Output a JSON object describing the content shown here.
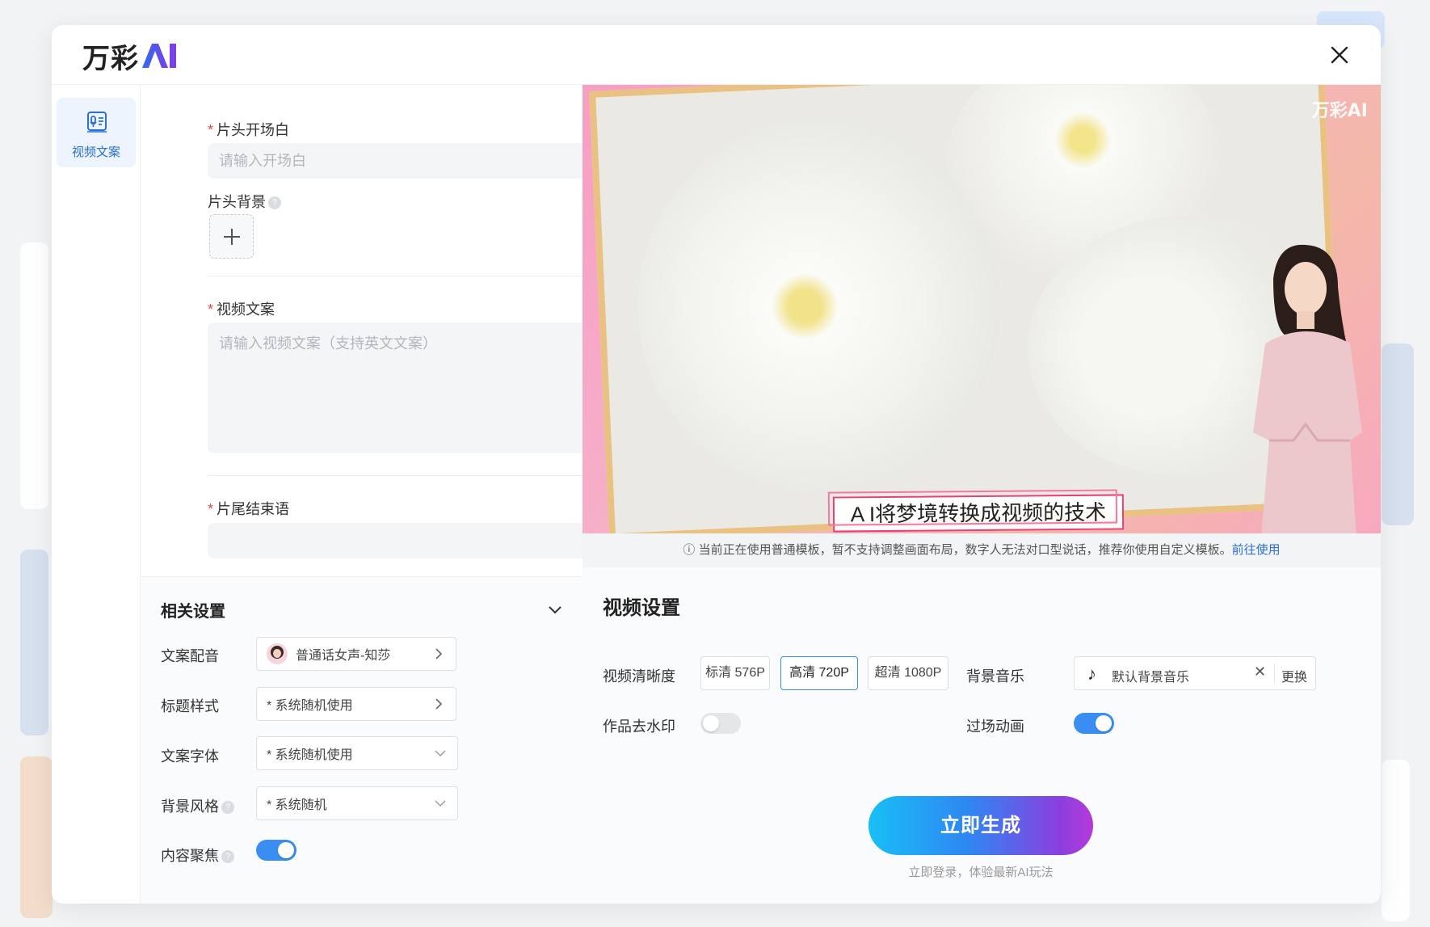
{
  "brand": {
    "name": "万彩",
    "accent": "#2a6fd6"
  },
  "rail": {
    "items": [
      {
        "label": "视频文案",
        "icon": "document-microphone-icon"
      }
    ]
  },
  "form": {
    "opening": {
      "label": "片头开场白",
      "placeholder": "请输入开场白"
    },
    "opening_bg": {
      "label": "片头背景"
    },
    "script": {
      "label": "视频文案",
      "placeholder": "请输入视频文案（支持英文文案）"
    },
    "ending": {
      "label": "片尾结束语"
    }
  },
  "related_settings": {
    "title": "相关设置",
    "voice": {
      "label": "文案配音",
      "value": "普通话女声-知莎"
    },
    "title_style": {
      "label": "标题样式",
      "value": "* 系统随机使用"
    },
    "font": {
      "label": "文案字体",
      "value": "* 系统随机使用"
    },
    "bg_style": {
      "label": "背景风格",
      "value": "* 系统随机"
    },
    "focus": {
      "label": "内容聚焦",
      "on": true
    }
  },
  "preview": {
    "caption": "A I将梦境转换成视频的技术",
    "watermark": "万彩AI",
    "notice_text": "当前正在使用普通模板，暂不支持调整画面布局，数字人无法对口型说话，推荐你使用自定义模板。",
    "notice_link": "前往使用"
  },
  "video_settings": {
    "title": "视频设置",
    "quality_label": "视频清晰度",
    "quality_options": [
      "标清 576P",
      "高清 720P",
      "超清 1080P"
    ],
    "quality_selected": "高清 720P",
    "music_label": "背景音乐",
    "music_value": "默认背景音乐",
    "music_change": "更换",
    "watermark_label": "作品去水印",
    "watermark_on": false,
    "transition_label": "过场动画",
    "transition_on": true
  },
  "generate": {
    "label": "立即生成",
    "sub": "立即登录，体验最新AI玩法"
  }
}
